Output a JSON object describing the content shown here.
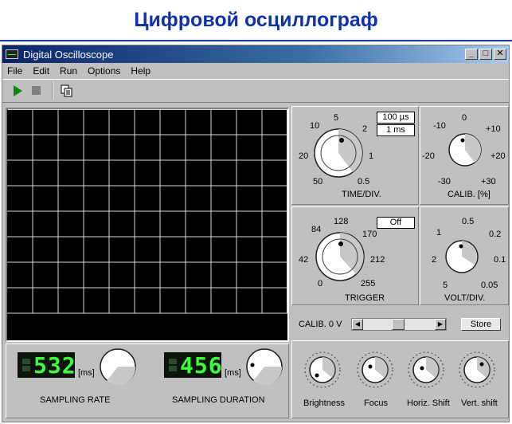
{
  "banner": {
    "title": "Цифровой осциллограф"
  },
  "window": {
    "title": "Digital Oscilloscope",
    "controls": {
      "minimize": "_",
      "maximize": "□",
      "close": "✕"
    }
  },
  "menu": [
    "File",
    "Edit",
    "Run",
    "Options",
    "Help"
  ],
  "toolbar": {
    "run_icon": "play-icon",
    "stop_icon": "stop-icon",
    "copy_icon": "copy-icon"
  },
  "time_div": {
    "label": "TIME/DIV.",
    "ticks": [
      "50",
      "20",
      "10",
      "5",
      "2",
      "1",
      "0.5"
    ],
    "button_top": "100 µs",
    "button_bottom": "1 ms"
  },
  "calib_pct": {
    "label": "CALIB. [%]",
    "ticks": [
      "-30",
      "-20",
      "-10",
      "0",
      "+10",
      "+20",
      "+30"
    ]
  },
  "trigger": {
    "label": "TRIGGER",
    "ticks": [
      "0",
      "42",
      "84",
      "128",
      "170",
      "212",
      "255"
    ],
    "button": "Off"
  },
  "volt_div": {
    "label": "VOLT/DIV.",
    "ticks": [
      "5",
      "2",
      "1",
      "0.5",
      "0.2",
      "0.1",
      "0.05"
    ]
  },
  "calib_v": {
    "label": "CALIB. 0 V",
    "store": "Store"
  },
  "sampling_rate": {
    "label": "SAMPLING RATE",
    "value": "532",
    "unit": "[ms]"
  },
  "sampling_duration": {
    "label": "SAMPLING DURATION",
    "value": "456",
    "unit": "[ms]"
  },
  "display_knobs": [
    "Brightness",
    "Focus",
    "Horiz. Shift",
    "Vert. shift"
  ]
}
